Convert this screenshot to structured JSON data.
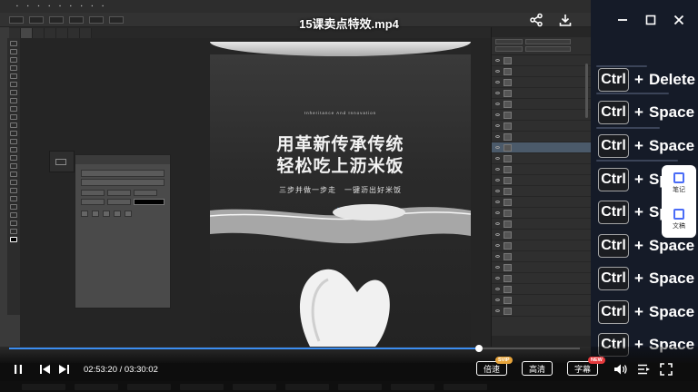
{
  "player": {
    "title": "15课卖点特效.mp4",
    "time": "02:53:20 / 03:30:02",
    "progress_fraction": 0.824,
    "speed_label": "倍速",
    "quality_label": "高清",
    "subtitle_label": "字幕",
    "svip_badge": "SVIP",
    "new_badge": "NEW",
    "icons": {
      "share": "share-icon",
      "download": "download-icon",
      "minimize": "minimize-icon",
      "maximize": "maximize-icon",
      "close": "close-icon",
      "play_pause": "pause-icon",
      "prev": "previous-icon",
      "next": "next-icon",
      "volume": "volume-icon",
      "playlist": "playlist-icon",
      "fullscreen": "fullscreen-icon"
    },
    "accent_color": "#3b8df0"
  },
  "side_widgets": [
    {
      "label": "笔记",
      "icon": "note-icon"
    },
    {
      "label": "文稿",
      "icon": "transcript-icon"
    }
  ],
  "shortcut_overlay": {
    "key": "Ctrl",
    "plus": "+",
    "rows": [
      "Delete",
      "Space",
      "Space",
      "Sp",
      "Sp",
      "Space",
      "Space",
      "Space",
      "Space"
    ]
  },
  "canvas": {
    "small_text": "Inheritance And Innovation",
    "headline_line1": "用革新传承传统",
    "headline_line2": "轻松吃上沥米饭",
    "subline": "三步并做一步走　一键沥出好米饭",
    "dots": "• • •"
  }
}
